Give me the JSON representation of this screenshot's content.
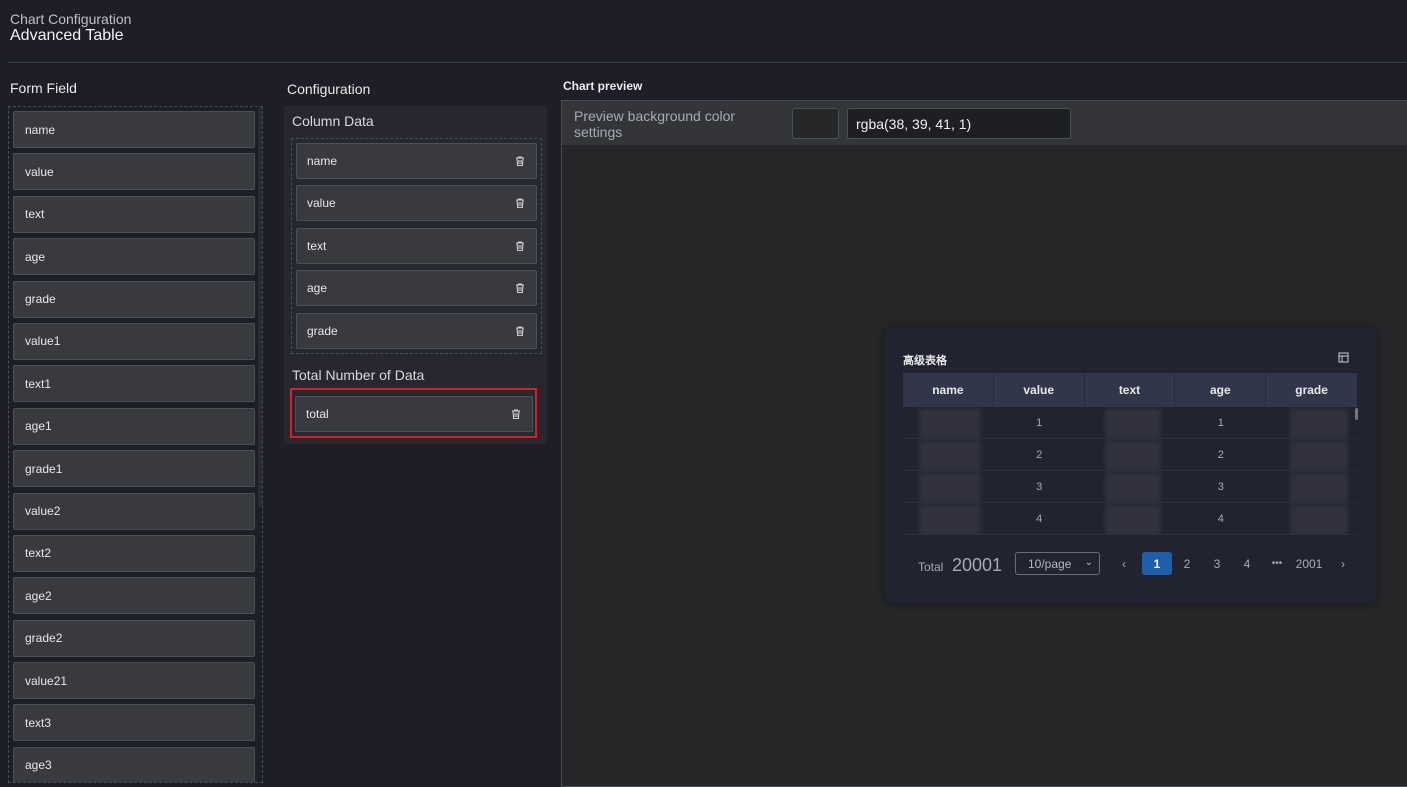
{
  "header": {
    "subtitle": "Chart Configuration",
    "title": "Advanced Table"
  },
  "form_field": {
    "title": "Form Field",
    "items": [
      "name",
      "value",
      "text",
      "age",
      "grade",
      "value1",
      "text1",
      "age1",
      "grade1",
      "value2",
      "text2",
      "age2",
      "grade2",
      "value21",
      "text3",
      "age3"
    ]
  },
  "configuration": {
    "title": "Configuration",
    "column_data_label": "Column Data",
    "columns": [
      "name",
      "value",
      "text",
      "age",
      "grade"
    ],
    "total_label": "Total Number of Data",
    "total_field": "total"
  },
  "preview": {
    "title": "Chart preview",
    "bg_label": "Preview background color settings",
    "bg_value": "rgba(38, 39, 41, 1)",
    "card": {
      "title": "高级表格",
      "headers": [
        "name",
        "value",
        "text",
        "age",
        "grade"
      ],
      "rows": [
        {
          "value": "1",
          "age": "1"
        },
        {
          "value": "2",
          "age": "2"
        },
        {
          "value": "3",
          "age": "3"
        },
        {
          "value": "4",
          "age": "4"
        }
      ],
      "pager": {
        "total_label": "Total",
        "total_value": "20001",
        "page_size": "10/page",
        "pages": [
          "1",
          "2",
          "3",
          "4"
        ],
        "ellipsis": "•••",
        "last_page": "2001",
        "prev": "‹",
        "next": "›"
      }
    }
  },
  "colors": {
    "active_page": "#1f5faa",
    "highlight_border": "#e01b24",
    "background": "#1d1e26"
  }
}
